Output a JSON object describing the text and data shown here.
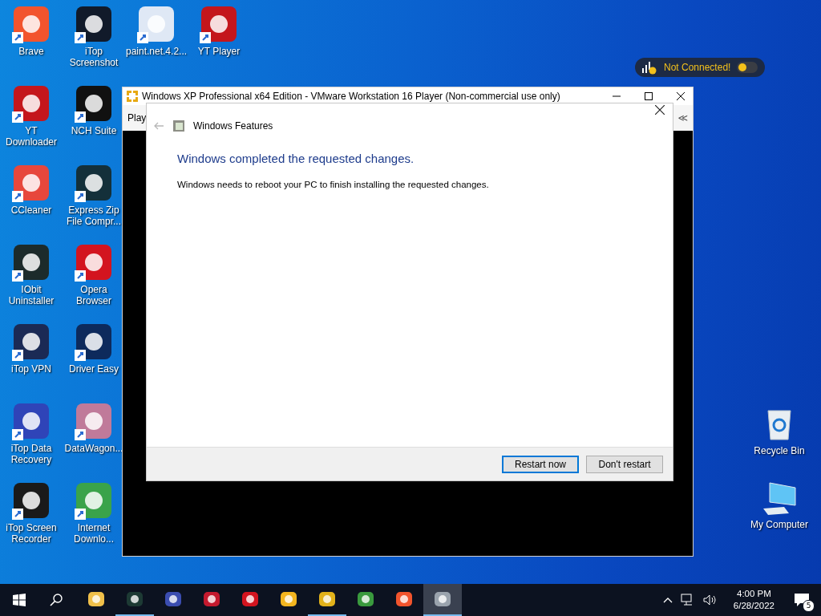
{
  "desktop": {
    "icons": [
      {
        "label": "Brave"
      },
      {
        "label": "iTop Screenshot"
      },
      {
        "label": "paint.net.4.2..."
      },
      {
        "label": "YT Player"
      },
      {
        "label": "YT Downloader"
      },
      {
        "label": "NCH Suite"
      },
      {
        "label": "CCleaner"
      },
      {
        "label": "Express Zip File Compr..."
      },
      {
        "label": "IObit Uninstaller"
      },
      {
        "label": "Opera Browser"
      },
      {
        "label": "iTop VPN"
      },
      {
        "label": "Driver Easy"
      },
      {
        "label": "iTop Data Recovery"
      },
      {
        "label": "DataWagon..."
      },
      {
        "label": "iTop Screen Recorder"
      },
      {
        "label": "Internet Downlo..."
      }
    ],
    "right_icons": [
      {
        "label": "Recycle Bin"
      },
      {
        "label": "My Computer"
      }
    ]
  },
  "vpn_widget": {
    "status": "Not Connected!",
    "on": false
  },
  "vm_window": {
    "title": "Windows XP Professional x64 Edition - VMware Workstation 16 Player (Non-commercial use only)",
    "menu": "Play",
    "collapse": "≪"
  },
  "dialog": {
    "title": "Windows Features",
    "heading": "Windows completed the requested changes.",
    "message": "Windows needs to reboot your PC to finish installing the requested changes.",
    "buttons": [
      {
        "label": "Restart now",
        "default": true
      },
      {
        "label": "Don't restart",
        "default": false
      }
    ]
  },
  "taskbar": {
    "apps": [
      {
        "running": false,
        "selected": false
      },
      {
        "running": true,
        "selected": false
      },
      {
        "running": false,
        "selected": false
      },
      {
        "running": false,
        "selected": false
      },
      {
        "running": false,
        "selected": false
      },
      {
        "running": false,
        "selected": false
      },
      {
        "running": true,
        "selected": false
      },
      {
        "running": false,
        "selected": false
      },
      {
        "running": false,
        "selected": false
      },
      {
        "running": true,
        "selected": true
      }
    ],
    "time": "4:00 PM",
    "date": "6/28/2022",
    "notifications": "5"
  }
}
